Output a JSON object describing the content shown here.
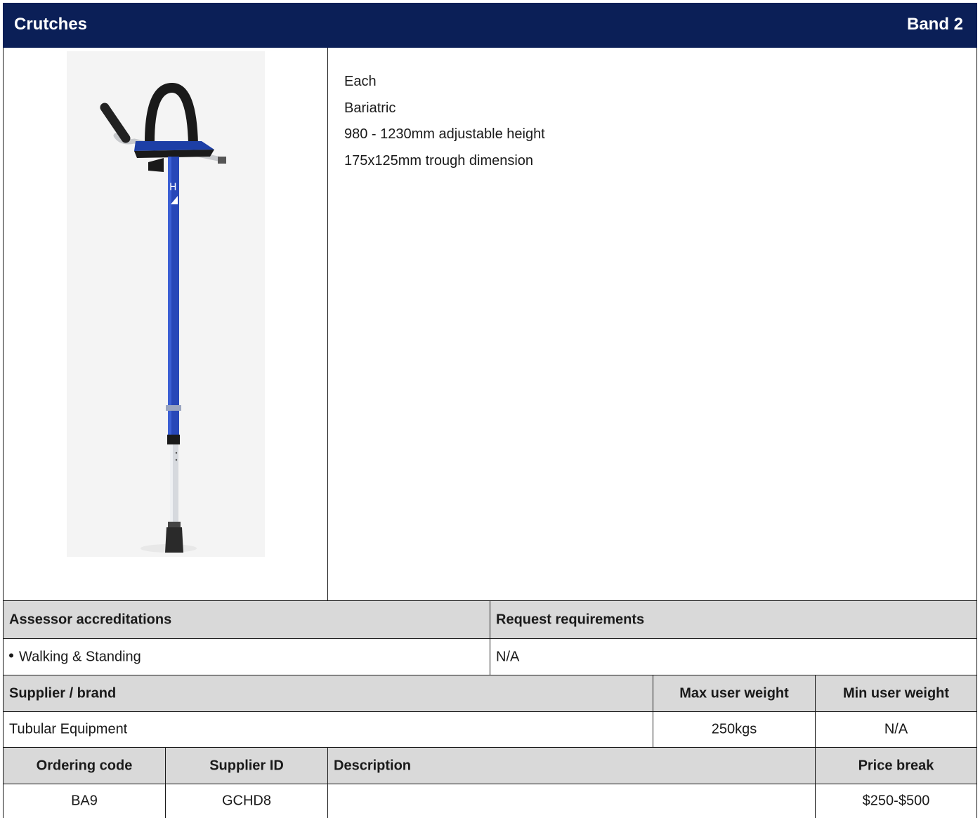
{
  "header": {
    "title": "Crutches",
    "band": "Band 2"
  },
  "product": {
    "image_alt": "crutch-image",
    "description_lines": [
      "Each",
      "Bariatric",
      "980 - 1230mm adjustable height",
      "175x125mm trough dimension"
    ]
  },
  "accreditations": {
    "header": "Assessor accreditations",
    "items": [
      "Walking & Standing"
    ]
  },
  "requirements": {
    "header": "Request requirements",
    "value": "N/A"
  },
  "supplier_table": {
    "headers": [
      "Supplier / brand",
      "Max user weight",
      "Min user weight"
    ],
    "row": [
      "Tubular Equipment",
      "250kgs",
      "N/A"
    ]
  },
  "ordering_table": {
    "headers": [
      "Ordering code",
      "Supplier ID",
      "Description",
      "Price break"
    ],
    "row": [
      "BA9",
      "GCHD8",
      "",
      "$250-$500"
    ]
  },
  "colors": {
    "header_bg": "#0b1f57",
    "table_header_bg": "#d9d9d9"
  }
}
